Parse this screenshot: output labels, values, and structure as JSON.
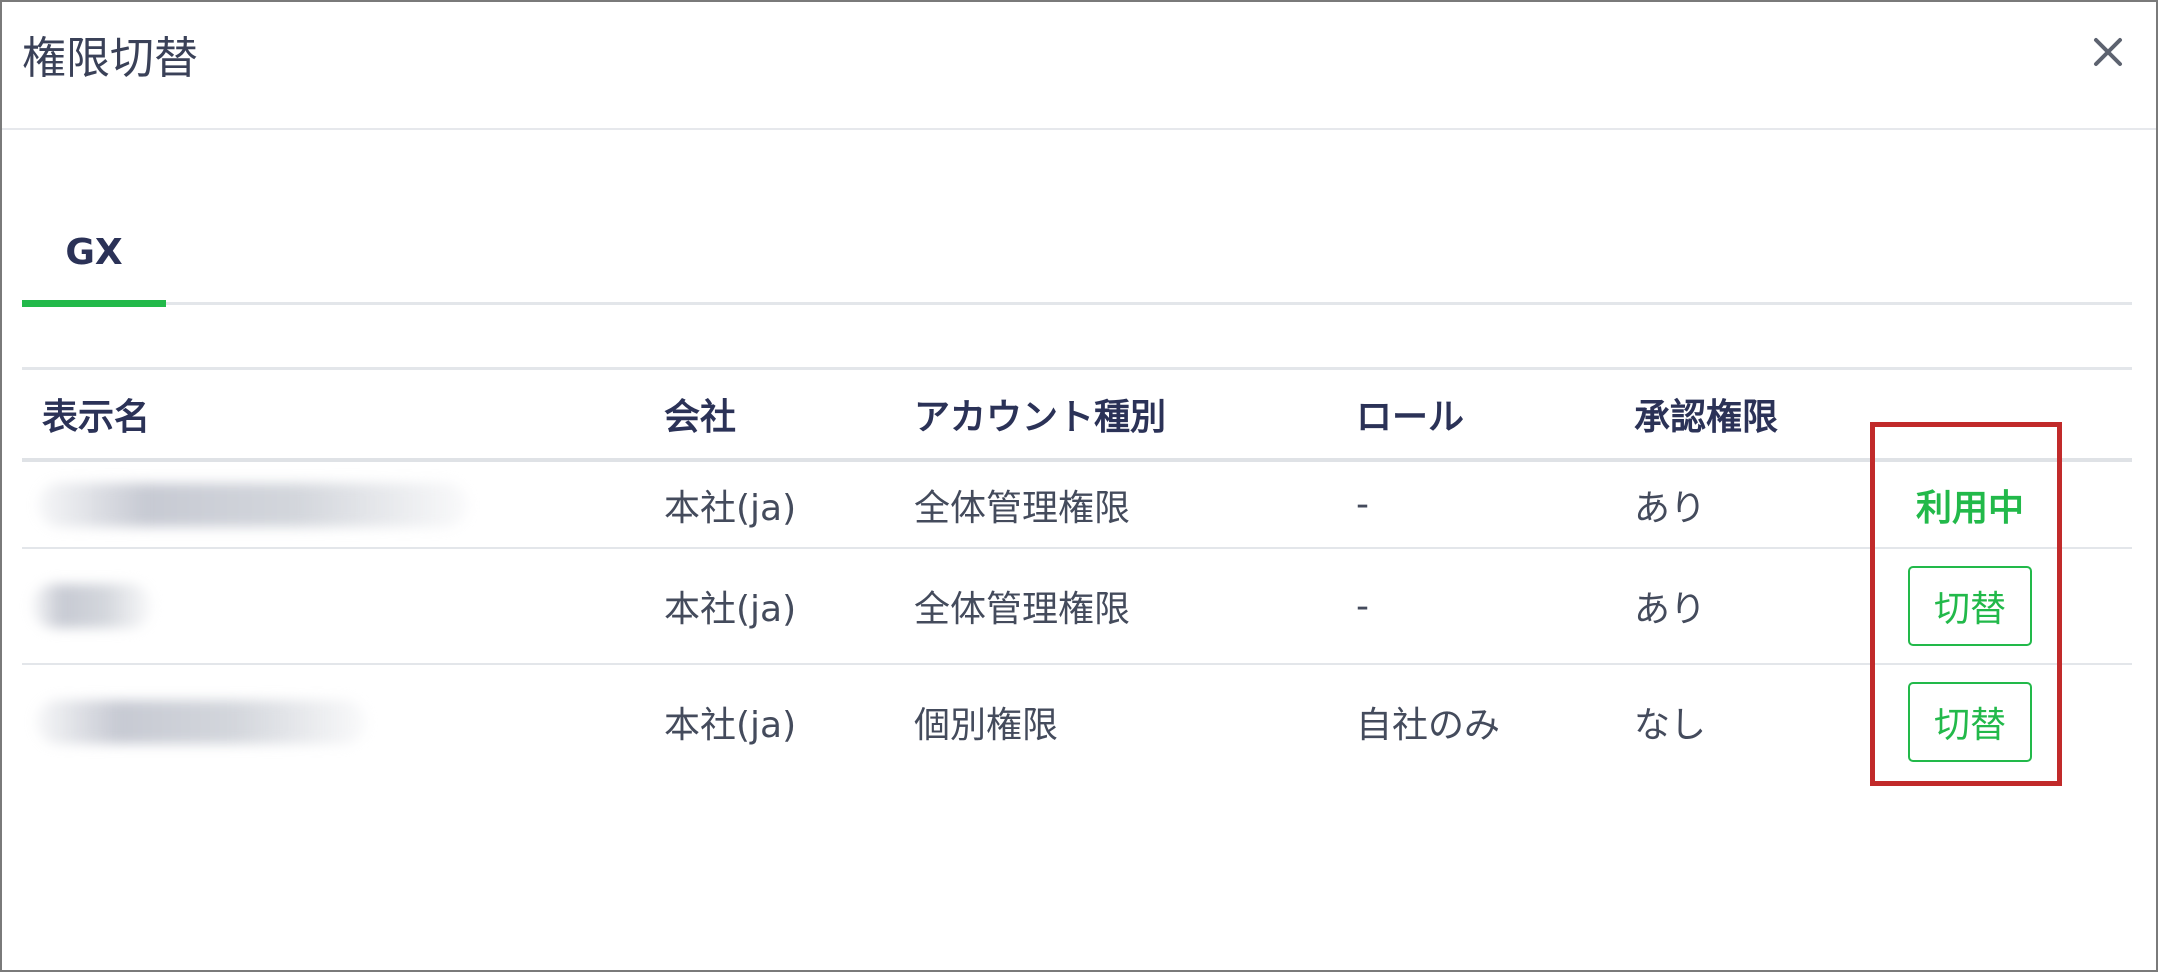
{
  "dialog": {
    "title": "権限切替",
    "close_label": "×"
  },
  "tabs": [
    {
      "label": "GX",
      "active": true
    }
  ],
  "table": {
    "headers": {
      "name": "表示名",
      "company": "会社",
      "account_type": "アカウント種別",
      "role": "ロール",
      "approval": "承認権限",
      "action": ""
    },
    "rows": [
      {
        "company": "本社(ja)",
        "account_type": "全体管理権限",
        "role": "-",
        "approval": "あり",
        "status": "利用中"
      },
      {
        "company": "本社(ja)",
        "account_type": "全体管理権限",
        "role": "-",
        "approval": "あり",
        "action_label": "切替"
      },
      {
        "company": "本社(ja)",
        "account_type": "個別権限",
        "role": "自社のみ",
        "approval": "なし",
        "action_label": "切替"
      }
    ]
  },
  "colors": {
    "accent_green": "#22b94a",
    "highlight_red": "#c12a2a",
    "title_text": "#3a4158"
  },
  "icons": {
    "close": "close-icon"
  }
}
